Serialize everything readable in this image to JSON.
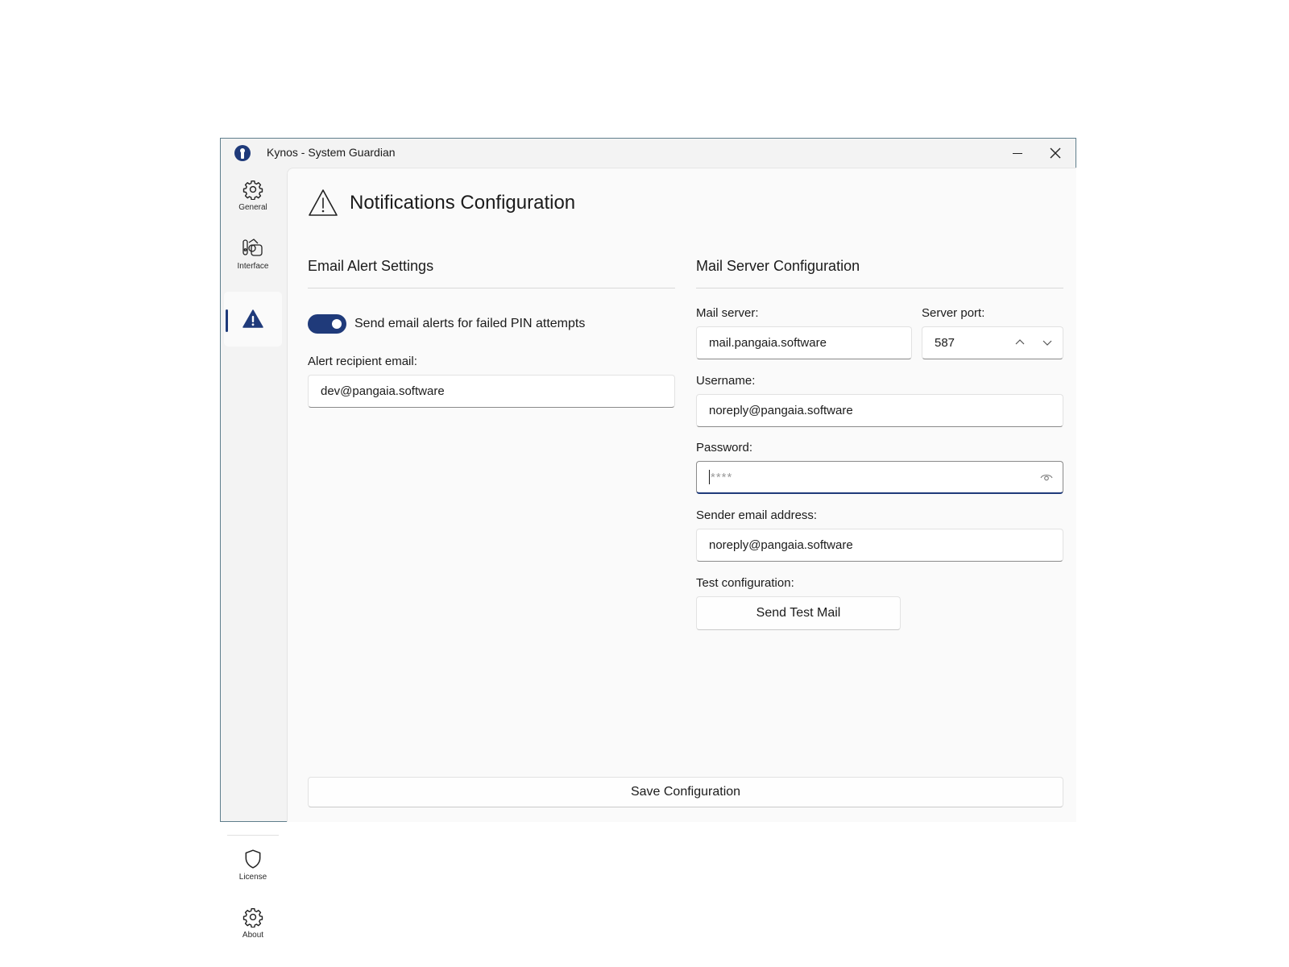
{
  "window": {
    "title": "Kynos - System Guardian"
  },
  "sidebar": {
    "items": [
      {
        "label": "General",
        "icon": "gear-icon"
      },
      {
        "label": "Interface",
        "icon": "interface-icon"
      },
      {
        "label": "",
        "icon": "warning-icon"
      }
    ],
    "footer_items": [
      {
        "label": "License",
        "icon": "shield-icon"
      },
      {
        "label": "About",
        "icon": "gear-icon"
      }
    ]
  },
  "page": {
    "title": "Notifications Configuration"
  },
  "email_alerts": {
    "section_title": "Email Alert Settings",
    "toggle_label": "Send email alerts for failed PIN attempts",
    "toggle_on": true,
    "recipient_label": "Alert recipient email:",
    "recipient_value": "dev@pangaia.software"
  },
  "mail_server": {
    "section_title": "Mail Server Configuration",
    "server_label": "Mail server:",
    "server_value": "mail.pangaia.software",
    "port_label": "Server port:",
    "port_value": "587",
    "username_label": "Username:",
    "username_value": "noreply@pangaia.software",
    "password_label": "Password:",
    "password_value": "****",
    "sender_label": "Sender email address:",
    "sender_value": "noreply@pangaia.software",
    "test_label": "Test configuration:",
    "test_button": "Send Test Mail"
  },
  "actions": {
    "save_button": "Save Configuration"
  },
  "colors": {
    "accent": "#1f3a7a"
  }
}
